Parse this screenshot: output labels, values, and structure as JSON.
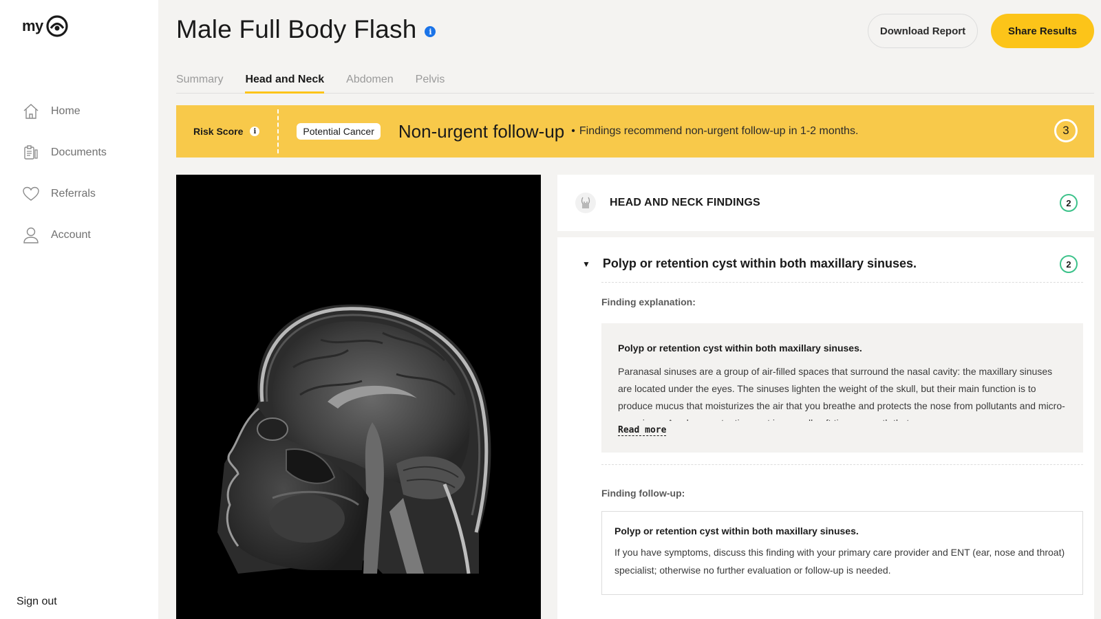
{
  "sidebar": {
    "logo_text": "my",
    "items": [
      {
        "label": "Home",
        "icon": "home-icon"
      },
      {
        "label": "Documents",
        "icon": "documents-icon"
      },
      {
        "label": "Referrals",
        "icon": "heart-icon"
      },
      {
        "label": "Account",
        "icon": "user-icon"
      }
    ],
    "signout_label": "Sign out"
  },
  "header": {
    "title": "Male Full Body Flash",
    "info_glyph": "i",
    "download_label": "Download Report",
    "share_label": "Share Results"
  },
  "tabs": [
    {
      "label": "Summary",
      "active": false
    },
    {
      "label": "Head and Neck",
      "active": true
    },
    {
      "label": "Abdomen",
      "active": false
    },
    {
      "label": "Pelvis",
      "active": false
    }
  ],
  "risk": {
    "label": "Risk Score",
    "info_glyph": "i",
    "chip": "Potential Cancer",
    "title": "Non-urgent follow-up",
    "bullet": "•",
    "description": "Findings recommend non-urgent follow-up in 1-2 months.",
    "score": "3"
  },
  "findings_header": {
    "title": "HEAD AND NECK FINDINGS",
    "count": "2"
  },
  "finding": {
    "title": "Polyp or retention cyst within both maxillary sinuses.",
    "count": "2",
    "caret": "▼",
    "explanation_label": "Finding explanation:",
    "explanation_title": "Polyp or retention cyst within both maxillary sinuses.",
    "explanation_body": "Paranasal sinuses are a group of air-filled spaces that surround the nasal cavity: the maxillary sinuses are located under the eyes. The sinuses lighten the weight of the skull, but their main function is to produce mucus that moisturizes the air that you breathe and protects the nose from pollutants and micro-organisms. A polyp or retention cyst is a small soft tissue growth that",
    "read_more": "Read more",
    "followup_label": "Finding follow-up:",
    "followup_title": "Polyp or retention cyst within both maxillary sinuses.",
    "followup_body": "If you have symptoms, discuss this finding with your primary care provider and ENT (ear, nose and throat) specialist; otherwise no further evaluation or follow-up is needed."
  },
  "colors": {
    "accent": "#fcc419",
    "banner": "#f8c94a",
    "badge_ring": "#3cc28a",
    "info_blue": "#1a73e8"
  }
}
